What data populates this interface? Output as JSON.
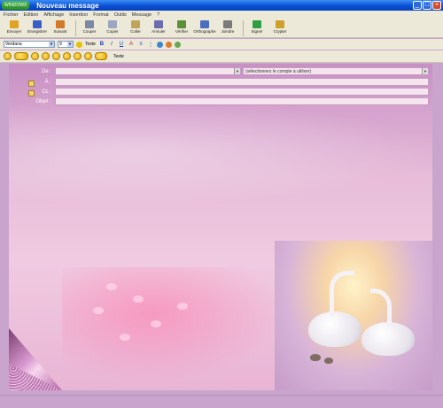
{
  "window": {
    "start_label": "WINDOWS",
    "title": "Nouveau message"
  },
  "menu": [
    "Fichier",
    "Edition",
    "Affichage",
    "Insertion",
    "Format",
    "Outils",
    "Message",
    "?"
  ],
  "toolbar": [
    {
      "label": "Envoyer",
      "icon": "send-icon",
      "color": "#e0a423"
    },
    {
      "label": "Enregistrer",
      "icon": "save-icon",
      "color": "#3a5fc6"
    },
    {
      "label": "Suivant",
      "icon": "print-icon",
      "color": "#d07a2a"
    },
    {
      "label": "Couper",
      "icon": "cut-icon",
      "color": "#7b88a6"
    },
    {
      "label": "Copier",
      "icon": "copy-icon",
      "color": "#9aa6c2"
    },
    {
      "label": "Coller",
      "icon": "paste-icon",
      "color": "#c2a35a"
    },
    {
      "label": "Annuler",
      "icon": "undo-icon",
      "color": "#6b6bb0"
    },
    {
      "label": "Vérifier",
      "icon": "check-icon",
      "color": "#5d8f3a"
    },
    {
      "label": "Orthographe",
      "icon": "spell-icon",
      "color": "#4a6fc0"
    },
    {
      "label": "Joindre",
      "icon": "attach-icon",
      "color": "#7a7a7a"
    },
    {
      "label": "Signer",
      "icon": "sign-icon",
      "color": "#2f9e44"
    },
    {
      "label": "Crypter",
      "icon": "encrypt-icon",
      "color": "#d0a12a"
    }
  ],
  "format": {
    "font": "Verdana",
    "size": "9",
    "style_label": "Texte"
  },
  "stationery_label": "Texte",
  "header": {
    "from_label": "De :",
    "from_value": "",
    "from_account": "(sélectionnez le compte à utiliser)",
    "to_label": "À :",
    "cc_label": "Cc :",
    "subject_label": "Objet :"
  },
  "body": {
    "signature_line1": "",
    "signature_line2": "",
    "credit": ""
  }
}
